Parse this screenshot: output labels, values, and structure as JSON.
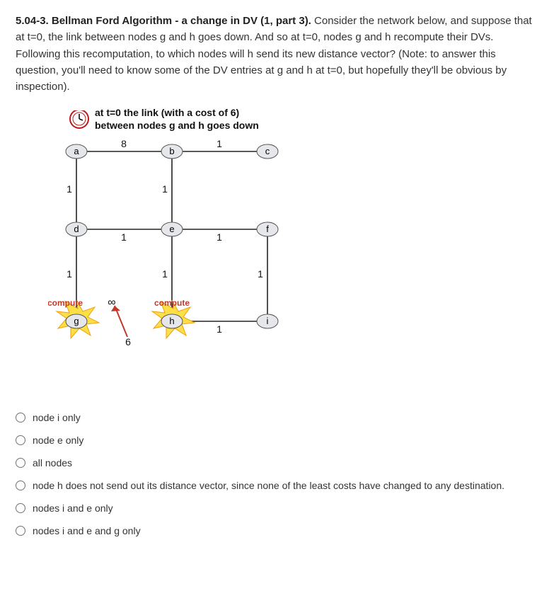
{
  "question": {
    "number_label": "5.04-3. Bellman Ford Algorithm - a change in DV (1, part 3).",
    "body": "Consider the network below, and suppose that at t=0, the link between nodes g and h goes down. And so at t=0, nodes g and h recompute their DVs.  Following this recomputation, to which nodes will h send its new distance vector?  (Note: to answer this question, you'll need to know some of the DV entries at g and h at t=0, but hopefully they'll be obvious by inspection)."
  },
  "figure": {
    "caption": "at t=0  the link (with a cost of 6)  between nodes g and h goes down",
    "nodes": {
      "a": "a",
      "b": "b",
      "c": "c",
      "d": "d",
      "e": "e",
      "f": "f",
      "g": "g",
      "h": "h",
      "i": "i"
    },
    "edge_labels": {
      "ab": "8",
      "bc": "1",
      "ad": "1",
      "be": "1",
      "de": "1",
      "ef": "1",
      "dg": "1",
      "eh": "1",
      "fi": "1",
      "gh_cost": "6",
      "gh_inf": "∞",
      "hi": "1"
    },
    "compute_g": "compute",
    "compute_h": "compute",
    "clock_alt": "clock-icon"
  },
  "options": [
    "node i only",
    "node e only",
    "all nodes",
    "node h does not send out its distance vector, since none of the least costs have changed to any destination.",
    "nodes i and e only",
    "nodes i and e and g only"
  ],
  "chart_data": {
    "type": "table",
    "description": "Weighted undirected graph (3x3 grid) with link g-h failed (cost 6 → ∞) at t=0; nodes g and h recompute distance vectors.",
    "nodes": [
      "a",
      "b",
      "c",
      "d",
      "e",
      "f",
      "g",
      "h",
      "i"
    ],
    "edges": [
      {
        "u": "a",
        "v": "b",
        "w": 8
      },
      {
        "u": "b",
        "v": "c",
        "w": 1
      },
      {
        "u": "a",
        "v": "d",
        "w": 1
      },
      {
        "u": "b",
        "v": "e",
        "w": 1
      },
      {
        "u": "d",
        "v": "e",
        "w": 1
      },
      {
        "u": "e",
        "v": "f",
        "w": 1
      },
      {
        "u": "d",
        "v": "g",
        "w": 1
      },
      {
        "u": "e",
        "v": "h",
        "w": 1
      },
      {
        "u": "f",
        "v": "i",
        "w": 1
      },
      {
        "u": "g",
        "v": "h",
        "w": 6,
        "status": "down_at_t0",
        "effective_w": "inf"
      },
      {
        "u": "h",
        "v": "i",
        "w": 1
      }
    ],
    "event": "link g-h goes down at t=0; g and h recompute DVs"
  }
}
